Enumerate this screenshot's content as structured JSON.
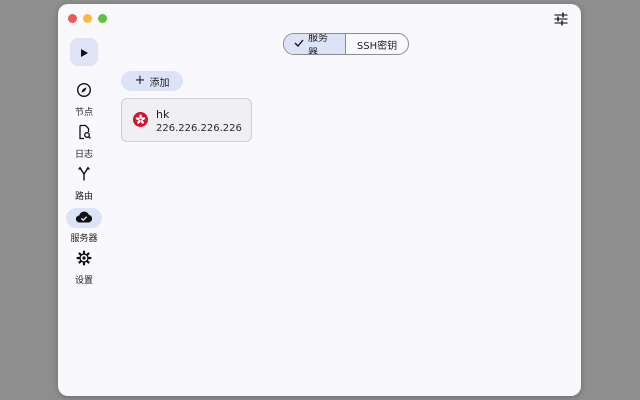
{
  "window": {
    "traffic_lights": [
      "close",
      "minimize",
      "zoom"
    ],
    "colors": {
      "red": "#ee5a52",
      "yellow": "#f4bd3f",
      "green": "#5bc33c",
      "accent": "#dde3f7"
    }
  },
  "sidebar": {
    "items": [
      {
        "id": "nodes",
        "label": "节点",
        "icon": "compass-icon",
        "active": false
      },
      {
        "id": "logs",
        "label": "日志",
        "icon": "log-search-icon",
        "active": false
      },
      {
        "id": "routes",
        "label": "路由",
        "icon": "fork-icon",
        "active": false
      },
      {
        "id": "servers",
        "label": "服务器",
        "icon": "cloud-check-icon",
        "active": true
      },
      {
        "id": "settings",
        "label": "设置",
        "icon": "gear-icon",
        "active": false
      }
    ]
  },
  "tabs": {
    "items": [
      {
        "label": "服务器",
        "selected": true
      },
      {
        "label": "SSH密钥",
        "selected": false
      }
    ]
  },
  "toolbar": {
    "add_label": "添加"
  },
  "servers": [
    {
      "name": "hk",
      "ip": "226.226.226.226",
      "flag": "hong-kong-flag-icon"
    }
  ]
}
